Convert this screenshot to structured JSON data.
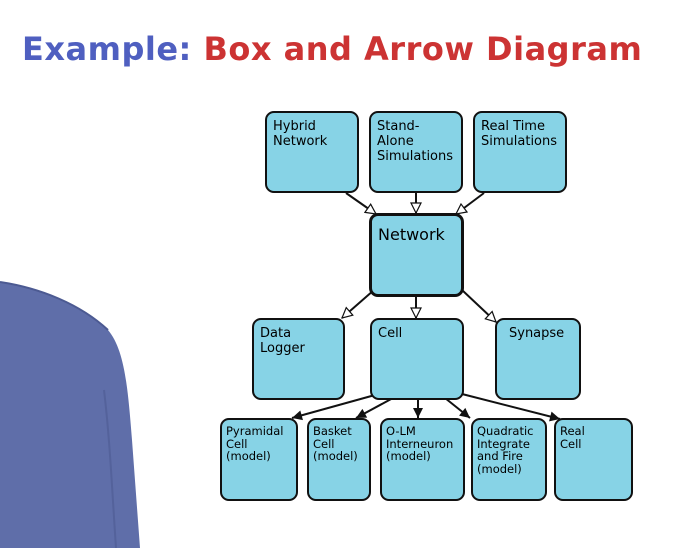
{
  "title": {
    "prefix": "Example:",
    "main": "Box and Arrow Diagram"
  },
  "colors": {
    "title_prefix": "#4f5fc0",
    "title_main": "#cc3333",
    "box_fill": "#87d3e6",
    "box_border": "#111111",
    "shirt": "#5f6ea9"
  },
  "diagram": {
    "top_row": [
      {
        "id": "hybrid",
        "label": "Hybrid\nNetwork"
      },
      {
        "id": "standalone",
        "label": "Stand-\nAlone\nSimulations"
      },
      {
        "id": "realtime",
        "label": "Real Time\nSimulations"
      }
    ],
    "center": {
      "id": "network",
      "label": "Network"
    },
    "middle_row": [
      {
        "id": "datalogger",
        "label": "Data\nLogger"
      },
      {
        "id": "cell",
        "label": "Cell"
      },
      {
        "id": "synapse",
        "label": "Synapse"
      }
    ],
    "bottom_row": [
      {
        "id": "pyramidal",
        "label": "Pyramidal\nCell\n(model)"
      },
      {
        "id": "basket",
        "label": "Basket\nCell\n(model)"
      },
      {
        "id": "olm",
        "label": "O-LM\nInterneuron\n(model)"
      },
      {
        "id": "quadratic",
        "label": "Quadratic\nIntegrate\nand Fire\n(model)"
      },
      {
        "id": "realcell",
        "label": "Real\nCell"
      }
    ]
  }
}
